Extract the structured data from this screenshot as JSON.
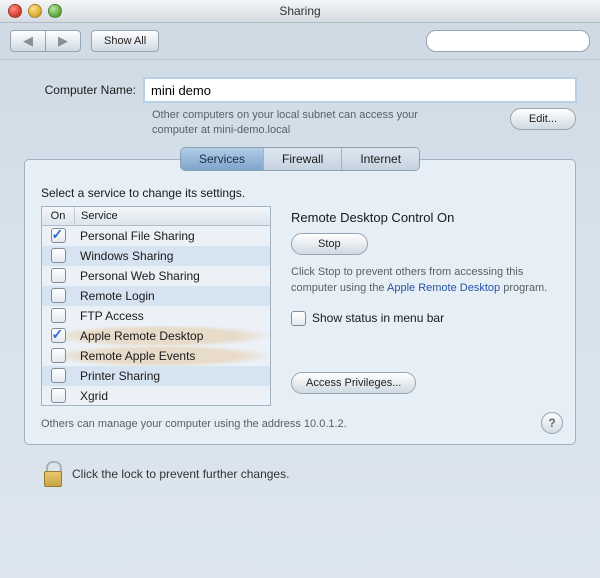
{
  "window": {
    "title": "Sharing"
  },
  "toolbar": {
    "show_all": "Show All",
    "search_placeholder": ""
  },
  "computer_name": {
    "label": "Computer Name:",
    "value": "mini demo",
    "subtext": "Other computers on your local subnet can access your computer at mini-demo.local",
    "edit_label": "Edit..."
  },
  "tabs": {
    "services": "Services",
    "firewall": "Firewall",
    "internet": "Internet",
    "active": "services"
  },
  "panel": {
    "prompt": "Select a service to change its settings.",
    "col_on": "On",
    "col_service": "Service",
    "services": [
      {
        "label": "Personal File Sharing",
        "on": true,
        "spot": false
      },
      {
        "label": "Windows Sharing",
        "on": false,
        "spot": false
      },
      {
        "label": "Personal Web Sharing",
        "on": false,
        "spot": false
      },
      {
        "label": "Remote Login",
        "on": false,
        "spot": false
      },
      {
        "label": "FTP Access",
        "on": false,
        "spot": false
      },
      {
        "label": "Apple Remote Desktop",
        "on": true,
        "spot": true
      },
      {
        "label": "Remote Apple Events",
        "on": false,
        "spot": true
      },
      {
        "label": "Printer Sharing",
        "on": false,
        "spot": false
      },
      {
        "label": "Xgrid",
        "on": false,
        "spot": false
      }
    ],
    "right": {
      "heading": "Remote Desktop Control On",
      "stop_label": "Stop",
      "desc_pre": "Click Stop to prevent others from accessing this computer using the ",
      "desc_link": "Apple Remote Desktop",
      "desc_post": " program.",
      "show_status_label": "Show status in menu bar",
      "show_status_checked": false,
      "access_priv_label": "Access Privileges..."
    },
    "footer": "Others can manage your computer using the address 10.0.1.2."
  },
  "lock": {
    "text": "Click the lock to prevent further changes."
  },
  "help": {
    "label": "?"
  }
}
